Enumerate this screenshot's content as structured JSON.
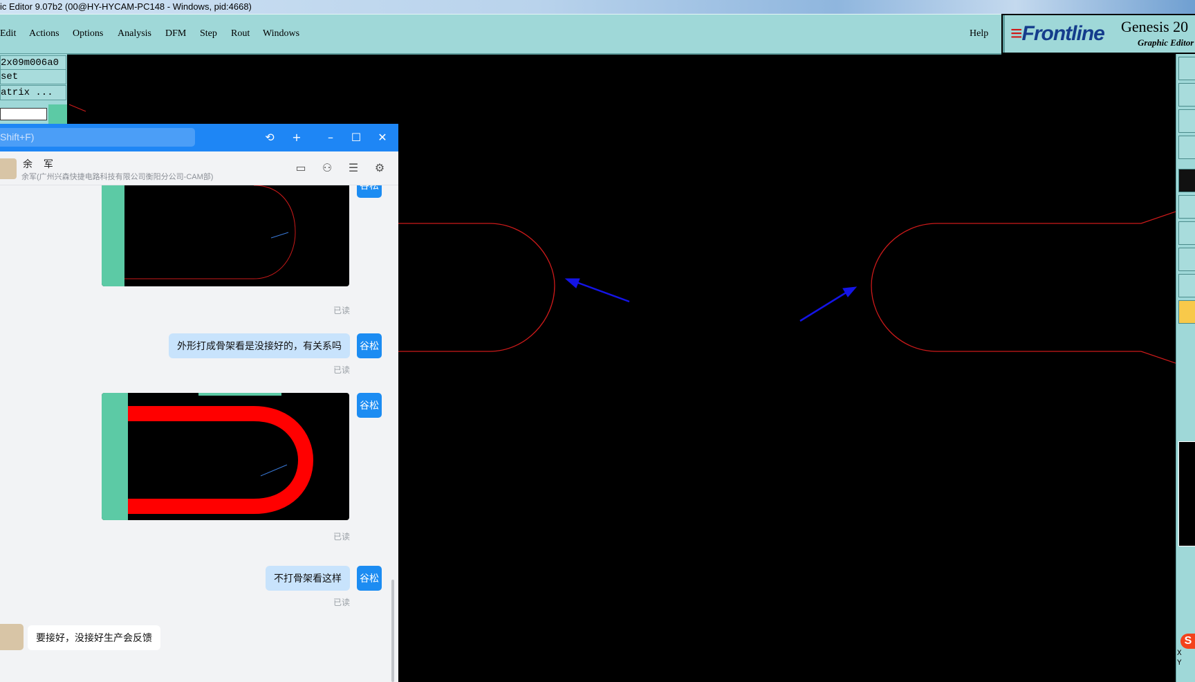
{
  "window": {
    "title": "ic Editor 9.07b2 (00@HY-HYCAM-PC148 - Windows, pid:4668)"
  },
  "menubar": {
    "items": [
      "Edit",
      "Actions",
      "Options",
      "Analysis",
      "DFM",
      "Step",
      "Rout",
      "Windows"
    ],
    "help": "Help"
  },
  "logo": {
    "brand": "Frontline",
    "product": "Genesis 20",
    "subtitle": "Graphic Editor"
  },
  "left_panel": {
    "job_name": "2x09m006a0",
    "set_label": "set",
    "matrix_label": "atrix ..."
  },
  "chat": {
    "search_placeholder": "Shift+F)",
    "contact_name": "余 军",
    "contact_subtitle": "余军(广州兴森快捷电路科技有限公司衡阳分公司-CAM部)",
    "my_avatar_label": "谷松",
    "read_label": "已读",
    "messages": [
      {
        "type": "image",
        "side": "right",
        "status": "已读"
      },
      {
        "type": "text",
        "side": "right",
        "text": "外形打成骨架看是没接好的，有关系吗",
        "status": "已读"
      },
      {
        "type": "image",
        "side": "right",
        "status": "已读"
      },
      {
        "type": "text",
        "side": "right",
        "text": "不打骨架看这样",
        "status": "已读"
      },
      {
        "type": "text",
        "side": "left",
        "text": "要接好，没接好生产会反馈"
      }
    ]
  },
  "right_toolbar": {
    "xy_label_x": "X",
    "xy_label_y": "Y"
  },
  "colors": {
    "canvas_bg": "#000000",
    "outline": "#cc1a1a",
    "arrow": "#1414e6",
    "menu_bg": "#9fd8d8",
    "chat_blue": "#1e86f5"
  }
}
